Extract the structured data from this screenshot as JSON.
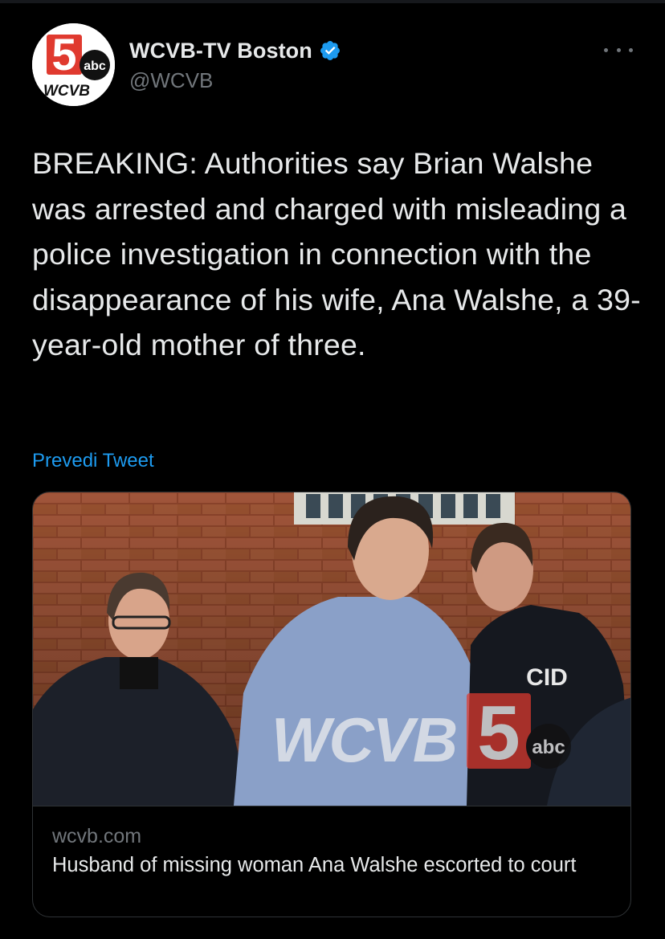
{
  "account": {
    "display_name": "WCVB-TV Boston",
    "handle": "@WCVB",
    "verified": true,
    "avatar_logo": {
      "number": "5",
      "network": "abc",
      "call_sign": "WCVB"
    }
  },
  "tweet": {
    "text": "BREAKING: Authorities say Brian Walshe was arrested and charged with misleading a police investigation in connection with the disappearance of his wife, Ana Walshe, a 39-year-old mother of three.",
    "translate_label": "Prevedi Tweet"
  },
  "link_card": {
    "domain": "wcvb.com",
    "title": "Husband of missing woman Ana Walshe escorted to court",
    "image_watermark": {
      "call_sign": "WCVB",
      "number": "5",
      "network": "abc"
    },
    "jacket_text": "CID"
  },
  "colors": {
    "background": "#000000",
    "primary_text": "#e7e9ea",
    "secondary_text": "#71767b",
    "link_blue": "#1d9bf0",
    "verified_blue": "#1d9bf0",
    "border": "#2f3336",
    "logo_red": "#e03a2f"
  },
  "icons": {
    "verified": "verified-badge-icon",
    "more": "more-horizontal-icon"
  }
}
